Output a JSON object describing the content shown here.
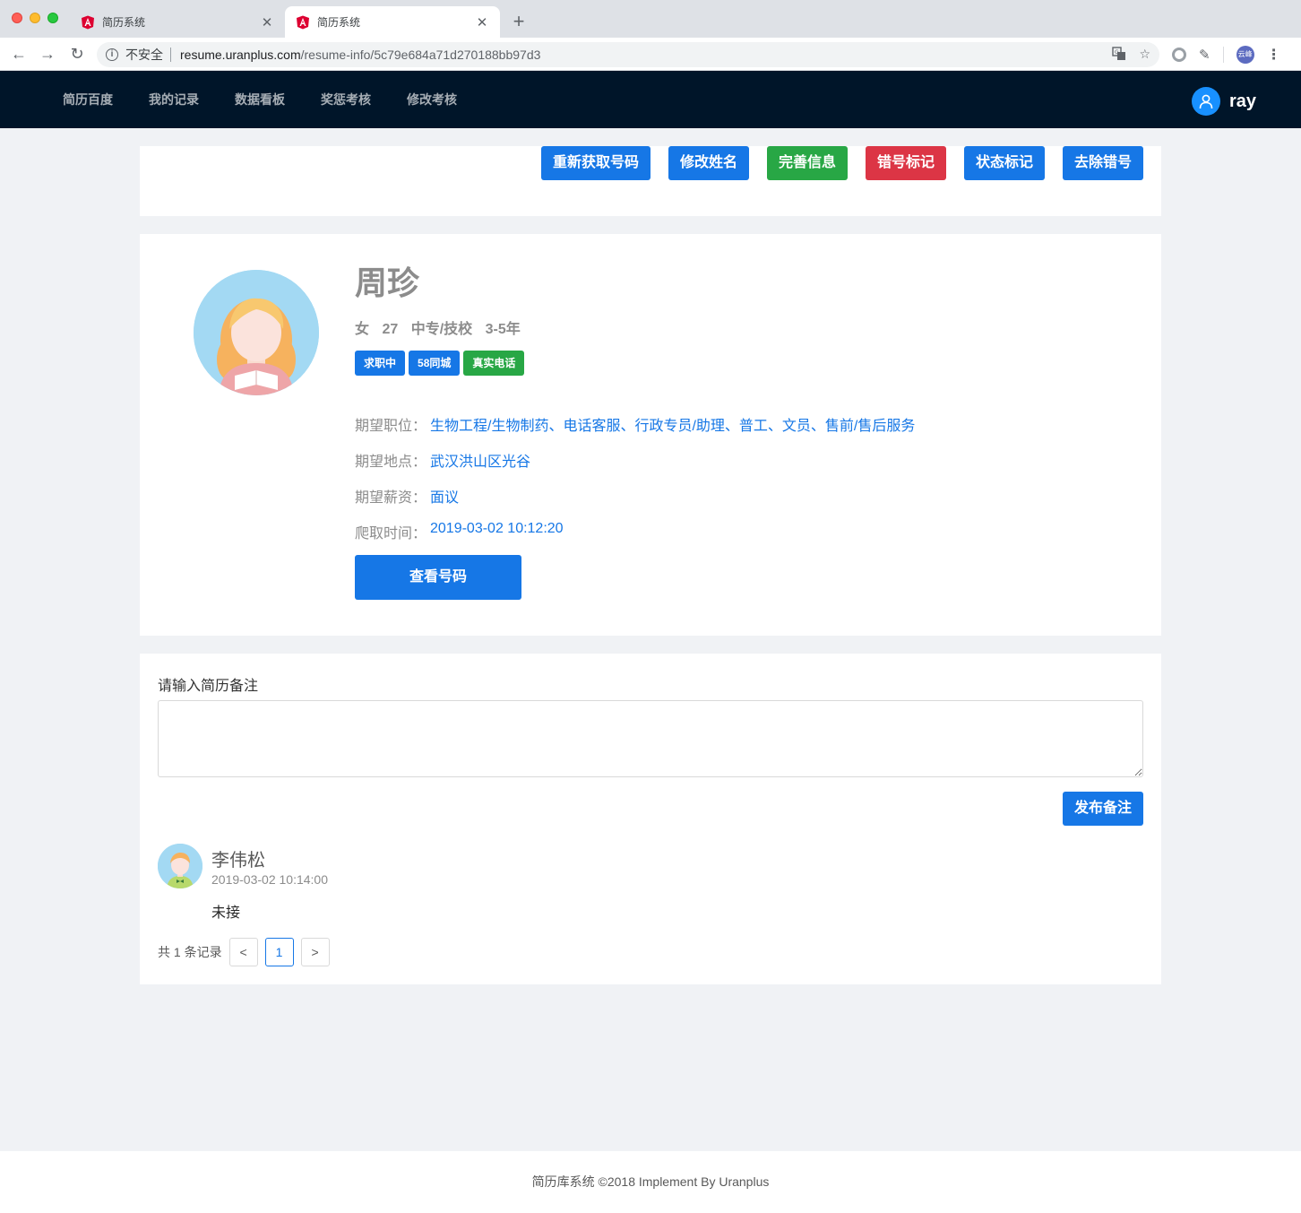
{
  "browser": {
    "tabs": [
      {
        "title": "简历系统"
      },
      {
        "title": "简历系统"
      }
    ],
    "new_tab_label": "+",
    "security_label": "不安全",
    "url_host": "resume.uranplus.com",
    "url_path": "/resume-info/5c79e684a71d270188bb97d3",
    "profile_badge": "云峰"
  },
  "nav": {
    "items": [
      "简历百度",
      "我的记录",
      "数据看板",
      "奖惩考核",
      "修改考核"
    ],
    "user_name": "ray"
  },
  "actions": {
    "refetch_number": "重新获取号码",
    "edit_name": "修改姓名",
    "complete_info": "完善信息",
    "wrong_number_mark": "错号标记",
    "status_mark": "状态标记",
    "remove_wrong_number": "去除错号"
  },
  "profile": {
    "name": "周珍",
    "gender": "女",
    "age": "27",
    "education": "中专/技校",
    "experience": "3-5年",
    "tags": [
      "求职中",
      "58同城",
      "真实电话"
    ],
    "fields": [
      {
        "label": "期望职位：",
        "value": "生物工程/生物制药、电话客服、行政专员/助理、普工、文员、售前/售后服务"
      },
      {
        "label": "期望地点：",
        "value": "武汉洪山区光谷"
      },
      {
        "label": "期望薪资：",
        "value": "面议"
      },
      {
        "label": "爬取时间：",
        "value": "2019-03-02 10:12:20"
      }
    ],
    "view_number_button": "查看号码"
  },
  "notes": {
    "label": "请输入简历备注",
    "input_value": "",
    "publish_button": "发布备注",
    "comments": [
      {
        "author": "李伟松",
        "time": "2019-03-02 10:14:00",
        "text": "未接"
      }
    ],
    "pagination": {
      "total_text": "共 1 条记录",
      "prev": "<",
      "current_page": "1",
      "next": ">"
    }
  },
  "footer": {
    "text": "简历库系统 ©2018 Implement By Uranplus"
  },
  "colors": {
    "primary": "#1677e6",
    "success": "#28a745",
    "danger": "#dc3545",
    "nav_bg": "#001529"
  },
  "icons": [
    "info-icon",
    "translate-icon",
    "star-icon",
    "user-icon",
    "chevron-left-icon",
    "chevron-right-icon"
  ]
}
